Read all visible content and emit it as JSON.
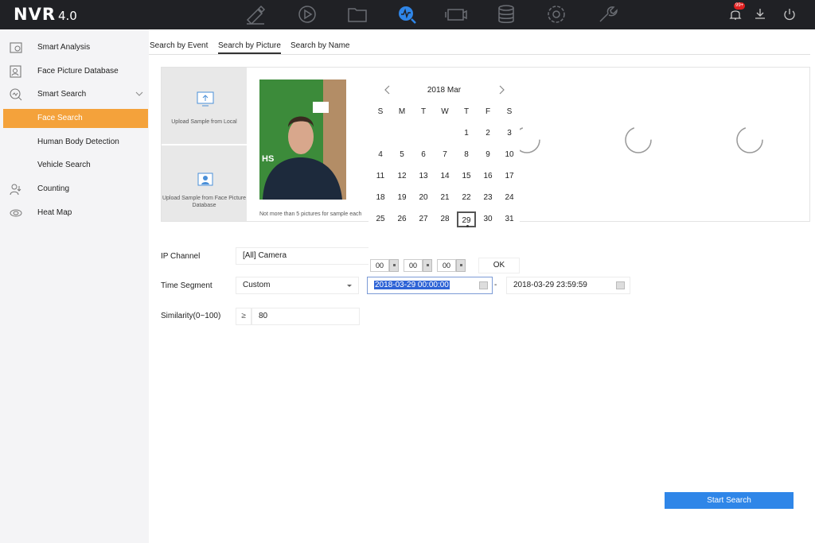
{
  "app": {
    "name": "NVR",
    "version": "4.0"
  },
  "topbar": {
    "nav_icons": [
      "live-view-icon",
      "playback-icon",
      "file-management-icon",
      "smart-analysis-icon",
      "camera-icon",
      "storage-icon",
      "configuration-icon",
      "maintenance-icon"
    ],
    "active_nav": "smart-analysis-icon",
    "notification_count": "99+"
  },
  "sidebar": {
    "items": [
      {
        "label": "Smart Analysis",
        "icon": "smart-analysis-icon"
      },
      {
        "label": "Face Picture Database",
        "icon": "face-database-icon"
      },
      {
        "label": "Smart Search",
        "icon": "smart-search-icon"
      },
      {
        "label": "Face Search",
        "icon": ""
      },
      {
        "label": "Human Body Detection",
        "icon": ""
      },
      {
        "label": "Vehicle Search",
        "icon": ""
      },
      {
        "label": "Counting",
        "icon": "counting-icon"
      },
      {
        "label": "Heat Map",
        "icon": "heat-map-icon"
      }
    ],
    "active_item": "Face Search"
  },
  "tabs": [
    {
      "label": "Search by Event"
    },
    {
      "label": "Search by Picture"
    },
    {
      "label": "Search by Name"
    }
  ],
  "active_tab": "Search by Picture",
  "upload": {
    "local_label": "Upload Sample from Local",
    "database_label": "Upload Sample from Face Picture Database",
    "note": "Not more than 5 pictures for sample each"
  },
  "sample_overlay_text": "HS",
  "calendar": {
    "month_label": "2018 Mar",
    "weekdays": [
      "S",
      "M",
      "T",
      "W",
      "T",
      "F",
      "S"
    ],
    "weeks": [
      [
        "",
        "",
        "",
        "",
        "1",
        "2",
        "3"
      ],
      [
        "4",
        "5",
        "6",
        "7",
        "8",
        "9",
        "10"
      ],
      [
        "11",
        "12",
        "13",
        "14",
        "15",
        "16",
        "17"
      ],
      [
        "18",
        "19",
        "20",
        "21",
        "22",
        "23",
        "24"
      ],
      [
        "25",
        "26",
        "27",
        "28",
        "29",
        "30",
        "31"
      ]
    ],
    "selected_day": "29",
    "time": {
      "hour": "00",
      "minute": "00",
      "second": "00"
    },
    "ok_label": "OK"
  },
  "form": {
    "ip_channel": {
      "label": "IP Channel",
      "value": "[All] Camera"
    },
    "time_segment": {
      "label": "Time Segment",
      "mode": "Custom",
      "start": "2018-03-29 00:00:00",
      "end": "2018-03-29 23:59:59",
      "separator": "-"
    },
    "similarity": {
      "label": "Similarity(0~100)",
      "operator": "≥",
      "value": "80"
    }
  },
  "start_button": "Start Search",
  "colors": {
    "topbar": "#202125",
    "active_menu": "#f4a23b",
    "primary_button": "#2f86e8",
    "nav_active": "#2f86e8"
  }
}
